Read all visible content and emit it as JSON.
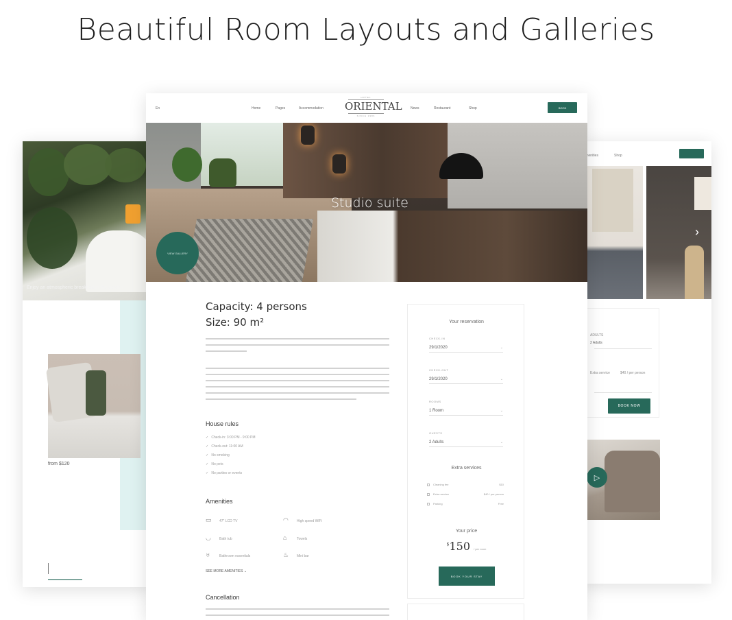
{
  "headline": "Beautiful Room Layouts and Galleries",
  "colors": {
    "accent": "#27695a",
    "mint": "#dff2f1"
  },
  "left_page": {
    "caption": "Enjoy an atmospheric breakfast in the garden",
    "price": "from $120"
  },
  "right_page": {
    "nav": [
      "Amenities",
      "Shop"
    ],
    "book_label": "BOOK",
    "chevron_icon": "chevron-right-icon",
    "form_label": "ADULTS",
    "form_value": "2 Adults",
    "service_left": "Extra service",
    "service_right": "$40 / per person",
    "book_now": "BOOK NOW",
    "play_icon": "play-icon"
  },
  "main_page": {
    "topbar": {
      "lang": "En",
      "nav_left": [
        "Home",
        "Pages",
        "Accommodation"
      ],
      "logo_small": "HOTEL",
      "logo": "ORIENTAL",
      "logo_sub": "SINCE 1986",
      "nav_right": [
        "News",
        "Restaurant",
        "Shop"
      ],
      "book_label": "BOOK"
    },
    "hero": {
      "title": "Studio suite",
      "circle_label": "VIEW GALLERY"
    },
    "capacity": "Capacity: 4 persons",
    "size": "Size: 90 m²",
    "house_rules": {
      "title": "House rules",
      "items": [
        "Check-in: 3:00 PM - 9:00 PM",
        "Check-out: 11:00 AM",
        "No smoking",
        "No pets",
        "No parties or events"
      ]
    },
    "amenities": {
      "title": "Amenities",
      "items": [
        {
          "icon": "tv-icon",
          "label": "47\" LCD TV"
        },
        {
          "icon": "wifi-icon",
          "label": "High speed WiFi"
        },
        {
          "icon": "bath-icon",
          "label": "Bath tub"
        },
        {
          "icon": "towel-icon",
          "label": "Towels"
        },
        {
          "icon": "hairdryer-icon",
          "label": "Bathroom essentials"
        },
        {
          "icon": "coffee-icon",
          "label": "Mini bar"
        }
      ],
      "see_more": "SEE MORE AMENITIES"
    },
    "cancellation": {
      "title": "Cancellation"
    },
    "reservation": {
      "title": "Your reservation",
      "checkin_label": "CHECK-IN",
      "checkin_value": "29/1/2020",
      "checkout_label": "CHECK-OUT",
      "checkout_value": "29/1/2020",
      "rooms_label": "ROOMS",
      "rooms_value": "1 Room",
      "guests_label": "GUESTS",
      "guests_value": "2 Adults",
      "extra_title": "Extra services",
      "extras": [
        {
          "label": "Cleaning fee",
          "price": "$10"
        },
        {
          "label": "Extra service",
          "price": "$40 / per person"
        },
        {
          "label": "Parking",
          "price": "Free"
        }
      ],
      "price_title": "Your price",
      "currency": "$",
      "price": "150",
      "per": "/ per room",
      "book_label": "BOOK YOUR STAY"
    }
  }
}
